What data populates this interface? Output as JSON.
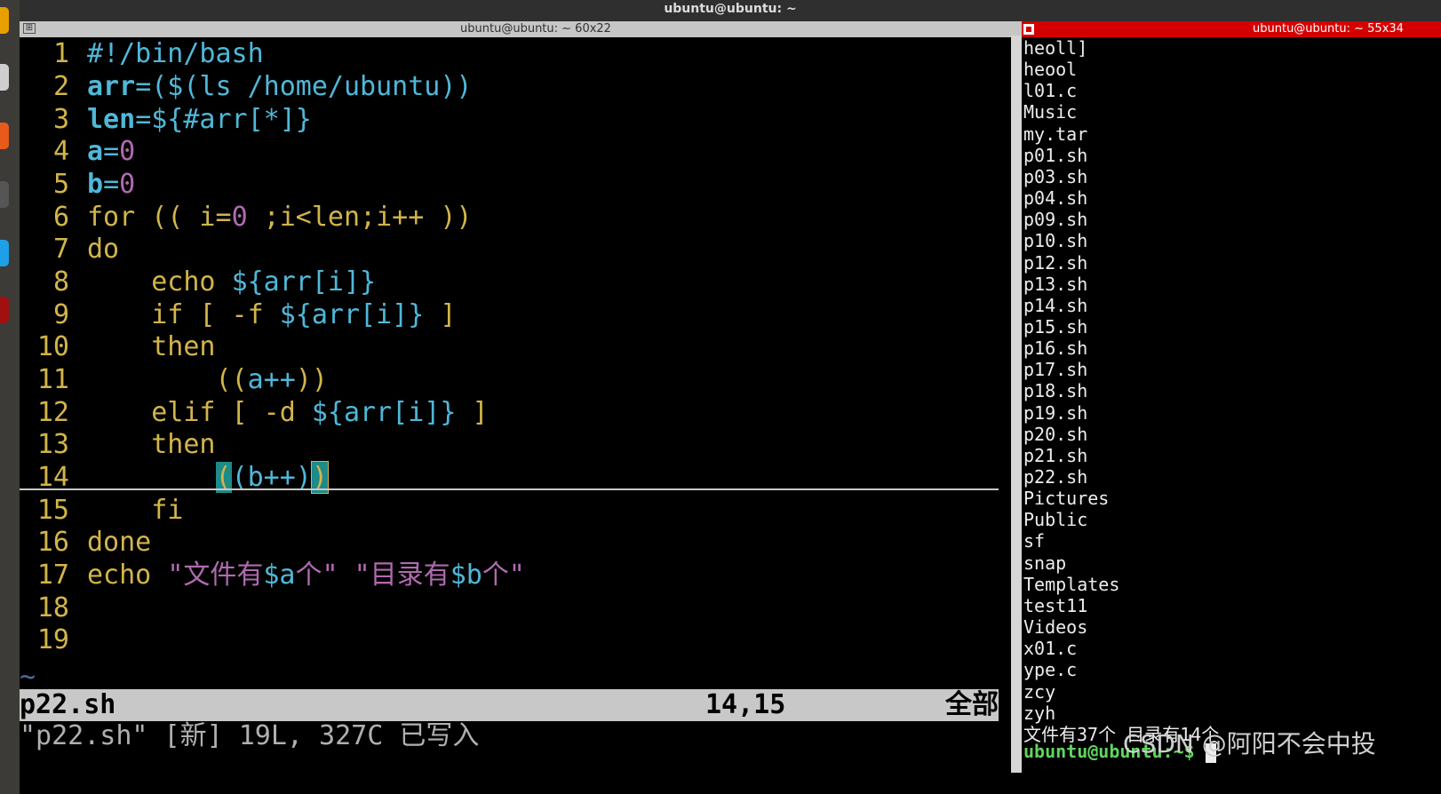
{
  "top_bar": {
    "title": "ubuntu@ubuntu: ~"
  },
  "left_terminal": {
    "title": "ubuntu@ubuntu: ~ 60x22",
    "lines": [
      {
        "n": "1",
        "code": "#!/bin/bash"
      },
      {
        "n": "2",
        "code": "arr=($(ls /home/ubuntu))"
      },
      {
        "n": "3",
        "code": "len=${#arr[*]}"
      },
      {
        "n": "4",
        "code": "a=0"
      },
      {
        "n": "5",
        "code": "b=0"
      },
      {
        "n": "6",
        "code": "for (( i=0 ;i<len;i++ ))"
      },
      {
        "n": "7",
        "code": "do"
      },
      {
        "n": "8",
        "code": "    echo ${arr[i]}"
      },
      {
        "n": "9",
        "code": "    if [ -f ${arr[i]} ]"
      },
      {
        "n": "10",
        "code": "    then"
      },
      {
        "n": "11",
        "code": "        ((a++))"
      },
      {
        "n": "12",
        "code": "    elif [ -d ${arr[i]} ]"
      },
      {
        "n": "13",
        "code": "    then"
      },
      {
        "n": "14",
        "code": "        ((b++))"
      },
      {
        "n": "15",
        "code": "    fi"
      },
      {
        "n": "16",
        "code": "done"
      },
      {
        "n": "17",
        "code": "echo \"文件有$a个\" \"目录有$b个\""
      },
      {
        "n": "18",
        "code": ""
      },
      {
        "n": "19",
        "code": ""
      }
    ],
    "tilde": "~",
    "status": {
      "file": "p22.sh",
      "position": "14,15",
      "scroll": "全部"
    },
    "command_line": "\"p22.sh\" [新] 19L, 327C 已写入"
  },
  "right_terminal": {
    "title": "ubuntu@ubuntu: ~ 55x34",
    "lines": [
      "heoll]",
      "heool",
      "l01.c",
      "Music",
      "my.tar",
      "p01.sh",
      "p03.sh",
      "p04.sh",
      "p09.sh",
      "p10.sh",
      "p12.sh",
      "p13.sh",
      "p14.sh",
      "p15.sh",
      "p16.sh",
      "p17.sh",
      "p18.sh",
      "p19.sh",
      "p20.sh",
      "p21.sh",
      "p22.sh",
      "Pictures",
      "Public",
      "sf",
      "snap",
      "Templates",
      "test11",
      "Videos",
      "x01.c",
      "ype.c",
      "zcy",
      "zyh",
      "文件有37个 目录有14个"
    ],
    "prompt": "ubuntu@ubuntu:~$ "
  },
  "watermark": "CSDN @阿阳不会中投",
  "colors": {
    "keyword": "#d2b54a",
    "variable": "#4fb8d8",
    "number": "#b06ab0",
    "status_bar": "#c8c8c8",
    "right_header": "#d40000",
    "prompt": "#5fd65f"
  }
}
